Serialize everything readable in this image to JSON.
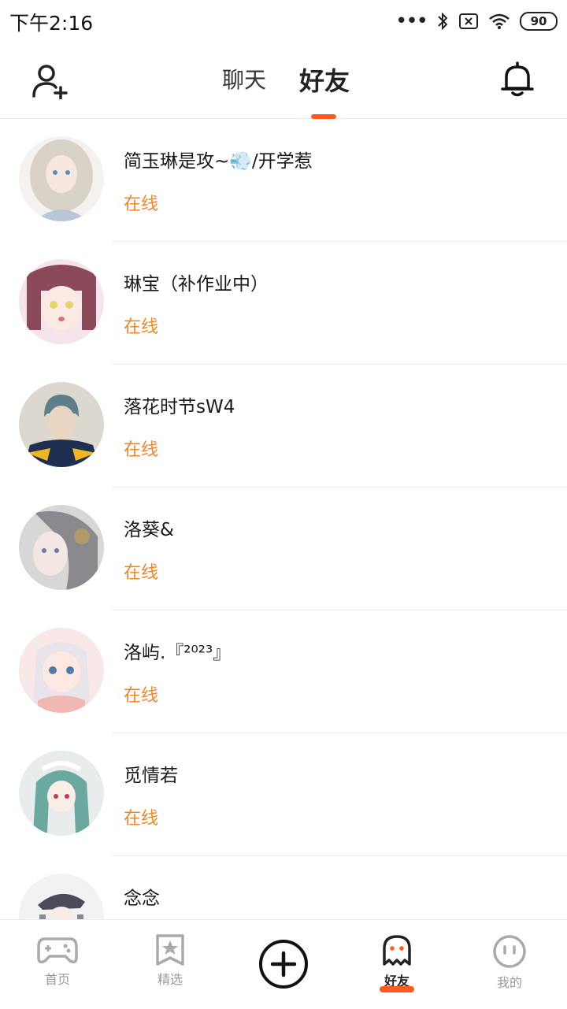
{
  "status_bar": {
    "time": "下午2:16",
    "battery": "90"
  },
  "header": {
    "tabs": [
      {
        "label": "聊天",
        "active": false
      },
      {
        "label": "好友",
        "active": true
      }
    ],
    "accent_color": "#ff5a1f"
  },
  "friends": [
    {
      "name": "简玉琳是攻~💨/开学惹",
      "status": "在线"
    },
    {
      "name": "琳宝（补作业中）",
      "status": "在线"
    },
    {
      "name": "落花时节sW4",
      "status": "在线"
    },
    {
      "name": "洛葵&",
      "status": "在线"
    },
    {
      "name": "洛屿.『²⁰²³』",
      "status": "在线"
    },
    {
      "name": "觅情若",
      "status": "在线"
    },
    {
      "name": "念念",
      "status": ""
    }
  ],
  "status_color": "#f0862a",
  "bottom_nav": [
    {
      "label": "首页",
      "icon": "gamepad-icon",
      "active": false
    },
    {
      "label": "精选",
      "icon": "bookmark-star-icon",
      "active": false
    },
    {
      "label": "",
      "icon": "plus-circle-icon",
      "active": false
    },
    {
      "label": "好友",
      "icon": "ghost-icon",
      "active": true
    },
    {
      "label": "我的",
      "icon": "face-icon",
      "active": false
    }
  ]
}
